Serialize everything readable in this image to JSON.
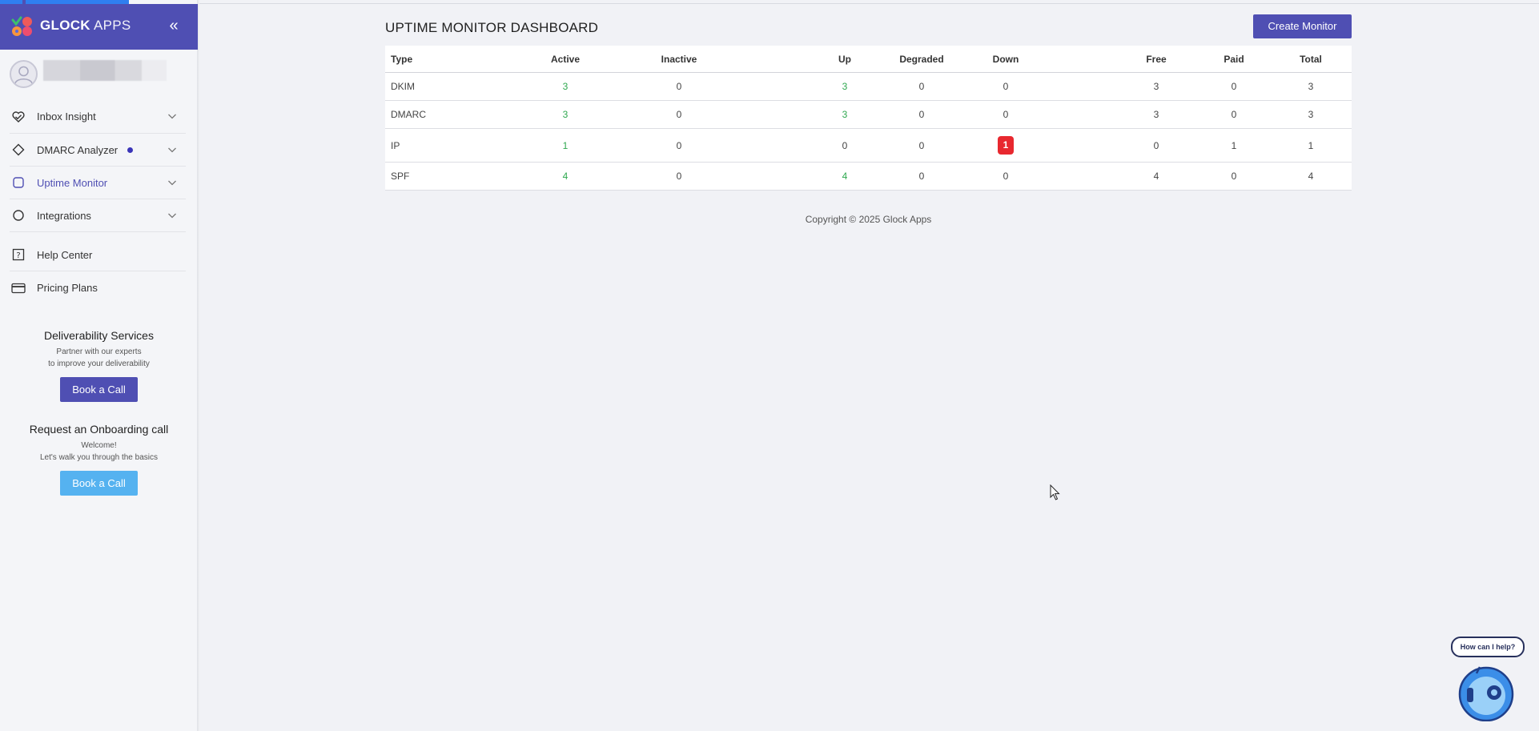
{
  "brand": {
    "name_bold": "GLOCK",
    "name_light": " APPS"
  },
  "sidebar": {
    "collapse_label": "«",
    "items": [
      {
        "label": "Inbox Insight",
        "icon": "heart-check-icon"
      },
      {
        "label": "DMARC Analyzer",
        "icon": "diamond-icon",
        "dot": true
      },
      {
        "label": "Uptime Monitor",
        "icon": "square-icon",
        "active": true
      },
      {
        "label": "Integrations",
        "icon": "circle-icon"
      },
      {
        "label": "Help Center",
        "icon": "question-icon"
      },
      {
        "label": "Pricing Plans",
        "icon": "card-icon"
      }
    ],
    "deliverability": {
      "title": "Deliverability Services",
      "line1": "Partner with our experts",
      "line2": "to improve your deliverability",
      "button": "Book a Call"
    },
    "onboarding": {
      "title": "Request an Onboarding call",
      "line1": "Welcome!",
      "line2": "Let's walk you through the basics",
      "button": "Book a Call"
    }
  },
  "main": {
    "title": "UPTIME MONITOR DASHBOARD",
    "create_button": "Create Monitor",
    "table": {
      "headers": [
        "Type",
        "Active",
        "Inactive",
        "Up",
        "Degraded",
        "Down",
        "Free",
        "Paid",
        "Total"
      ],
      "rows": [
        [
          "DKIM",
          "3",
          "0",
          "3",
          "0",
          "0",
          "3",
          "0",
          "3"
        ],
        [
          "DMARC",
          "3",
          "0",
          "3",
          "0",
          "0",
          "3",
          "0",
          "3"
        ],
        [
          "IP",
          "1",
          "0",
          "0",
          "0",
          "1",
          "0",
          "1",
          "1"
        ],
        [
          "SPF",
          "4",
          "0",
          "4",
          "0",
          "0",
          "4",
          "0",
          "4"
        ]
      ]
    },
    "copyright": "Copyright © 2025 Glock Apps"
  },
  "help_widget": {
    "bubble": "How can I help?"
  },
  "colors": {
    "brand": "#4f4fb3",
    "accent_blue": "#55b2f0",
    "success": "#2fa84f",
    "danger": "#e8282f"
  }
}
